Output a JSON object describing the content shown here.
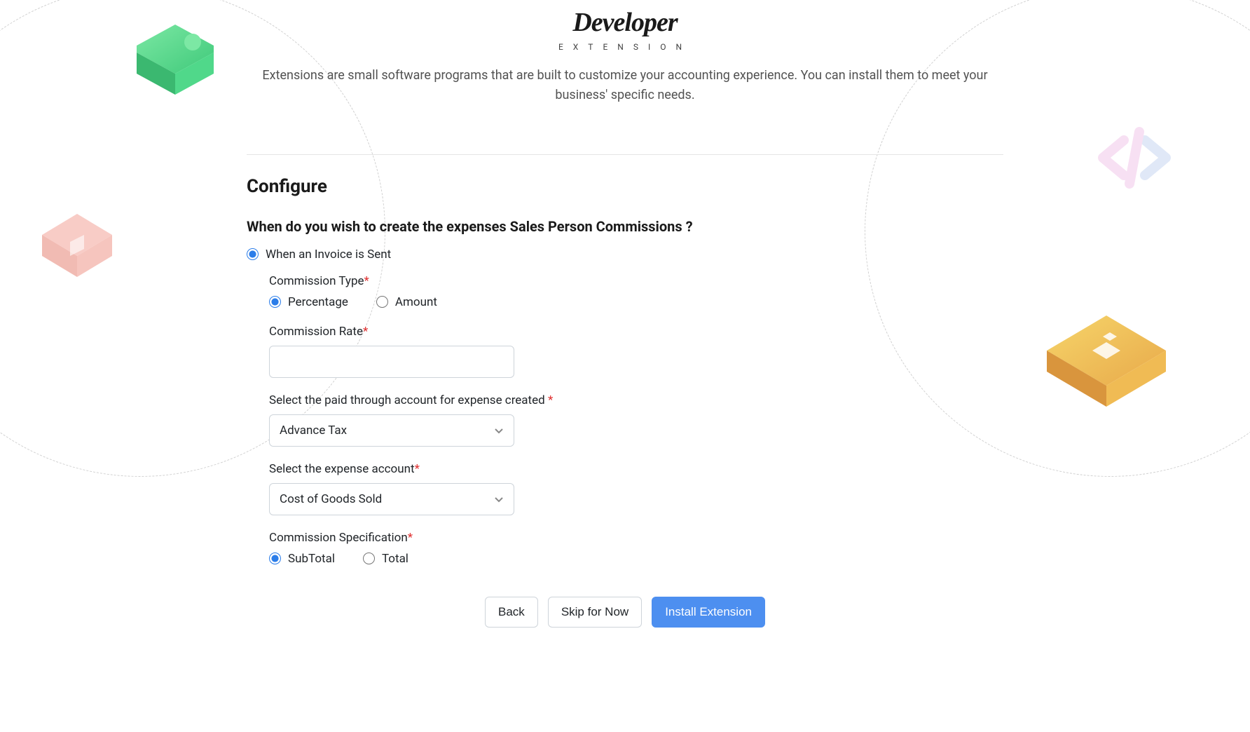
{
  "header": {
    "logo_title": "Developer",
    "logo_subtitle": "EXTENSION",
    "description": "Extensions are small software programs that are built to customize your accounting experience. You can install them to meet your business' specific needs."
  },
  "configure": {
    "title": "Configure",
    "question": "When do you wish to create the expenses Sales Person Commissions ?",
    "trigger_option": "When an Invoice is Sent",
    "commission_type": {
      "label": "Commission Type",
      "options": {
        "percentage": "Percentage",
        "amount": "Amount"
      },
      "selected": "percentage"
    },
    "commission_rate": {
      "label": "Commission Rate",
      "value": ""
    },
    "paid_through": {
      "label": "Select the paid through account for expense created ",
      "value": "Advance Tax"
    },
    "expense_account": {
      "label": "Select the expense account",
      "value": "Cost of Goods Sold"
    },
    "commission_spec": {
      "label": "Commission Specification",
      "options": {
        "subtotal": "SubTotal",
        "total": "Total"
      },
      "selected": "subtotal"
    }
  },
  "footer": {
    "back": "Back",
    "skip": "Skip for Now",
    "install": "Install Extension"
  }
}
